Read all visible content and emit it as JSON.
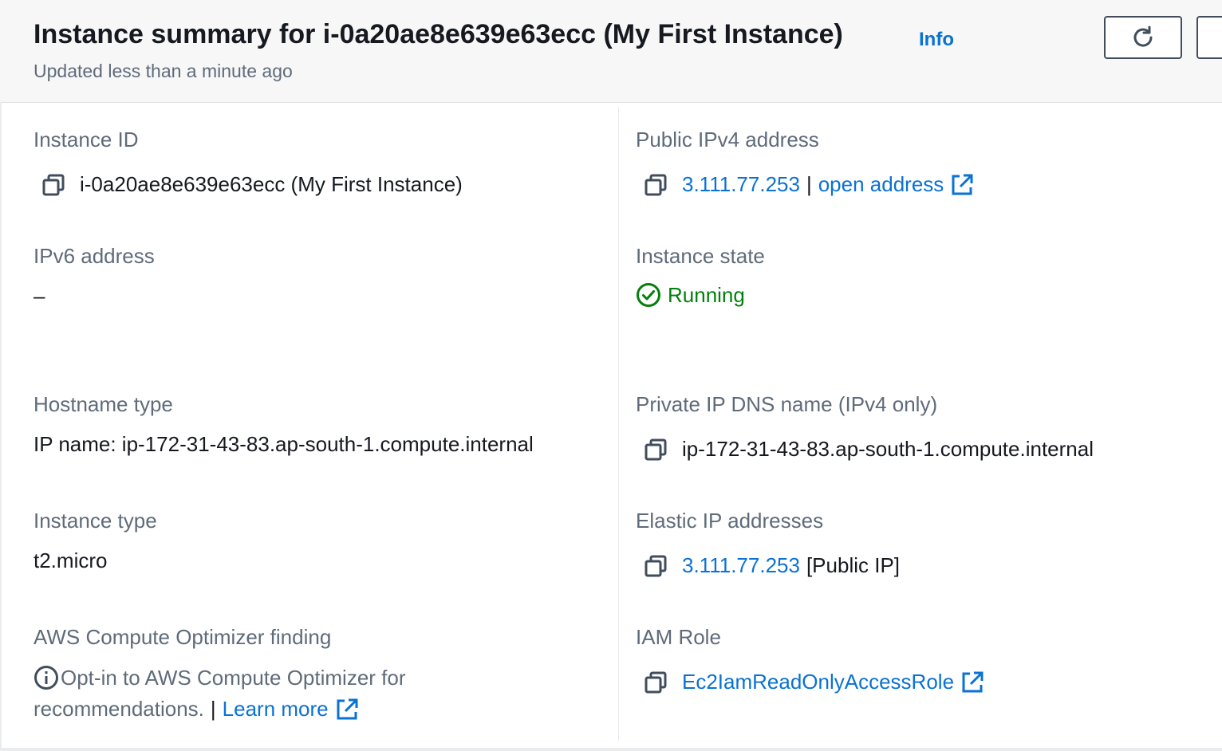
{
  "header": {
    "title": "Instance summary for i-0a20ae8e639e63ecc (My First Instance)",
    "info_link": "Info",
    "subtitle": "Updated less than a minute ago"
  },
  "fields": {
    "instance_id": {
      "label": "Instance ID",
      "value": "i-0a20ae8e639e63ecc (My First Instance)"
    },
    "public_ipv4": {
      "label": "Public IPv4 address",
      "ip": "3.111.77.253",
      "separator": "|",
      "open_link": "open address"
    },
    "ipv6": {
      "label": "IPv6 address",
      "value": "–"
    },
    "instance_state": {
      "label": "Instance state",
      "value": "Running"
    },
    "hostname_type": {
      "label": "Hostname type",
      "value": "IP name: ip-172-31-43-83.ap-south-1.compute.internal"
    },
    "private_dns": {
      "label": "Private IP DNS name (IPv4 only)",
      "value": "ip-172-31-43-83.ap-south-1.compute.internal"
    },
    "instance_type": {
      "label": "Instance type",
      "value": "t2.micro"
    },
    "elastic_ip": {
      "label": "Elastic IP addresses",
      "ip": "3.111.77.253",
      "suffix": "[Public IP]"
    },
    "optimizer": {
      "label": "AWS Compute Optimizer finding",
      "line1": "Opt-in to AWS Compute Optimizer for",
      "line2": "recommendations.",
      "separator": "|",
      "learn_more": "Learn more"
    },
    "iam_role": {
      "label": "IAM Role",
      "value": "Ec2IamReadOnlyAccessRole"
    }
  },
  "colors": {
    "link": "#0972d3",
    "success": "#037f0c",
    "label": "#5f6b7a",
    "text": "#16191f"
  },
  "icons": [
    "refresh-icon",
    "copy-icon",
    "external-link-icon",
    "status-check-icon",
    "info-circle-icon"
  ]
}
